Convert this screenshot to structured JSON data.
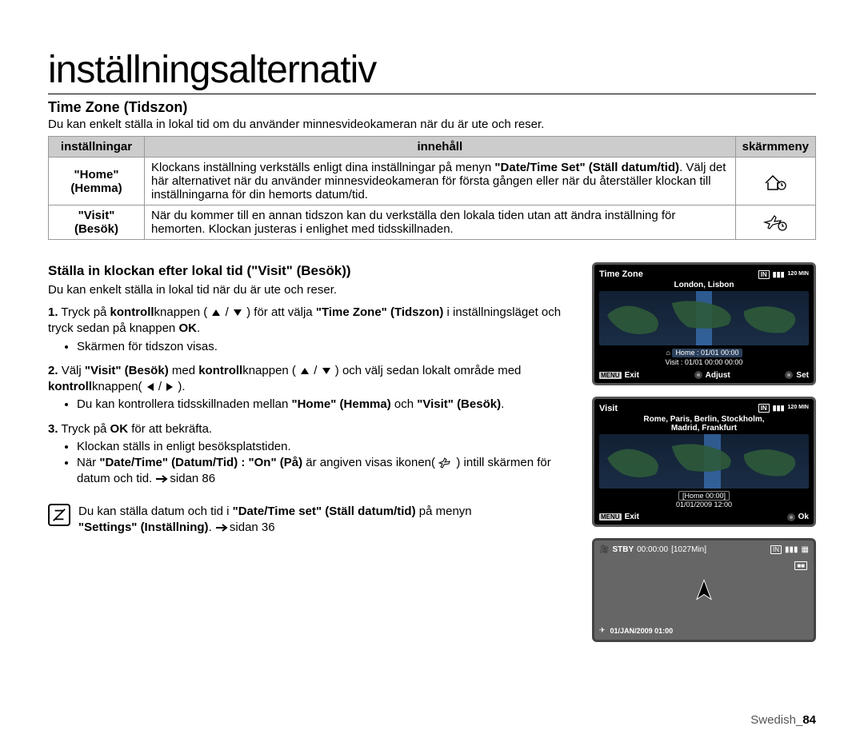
{
  "page_title": "inställningsalternativ",
  "section": {
    "heading": "Time Zone (Tidszon)",
    "desc": "Du kan enkelt ställa in lokal tid om du använder minnesvideokameran när du är ute och reser."
  },
  "table": {
    "headers": [
      "inställningar",
      "innehåll",
      "skärmmeny"
    ],
    "rows": [
      {
        "setting_q": "\"Home\"",
        "setting_p": "(Hemma)",
        "content_a": "Klockans inställning verkställs enligt dina inställningar på menyn ",
        "content_b": "\"Date/Time Set\" (Ställ datum/tid)",
        "content_c": ". Välj det här alternativet när du använder minnesvideokameran för första gången eller när du återställer klockan till inställningarna för din hemorts datum/tid.",
        "icon": "home"
      },
      {
        "setting_q": "\"Visit\"",
        "setting_p": "(Besök)",
        "content_a": "När du kommer till en annan tidszon kan du verkställa den lokala tiden utan att ändra inställning för hemorten. Klockan justeras i enlighet med tidsskillnaden.",
        "icon": "visit"
      }
    ]
  },
  "sub_heading": "Ställa in klockan efter lokal tid (\"Visit\" (Besök))",
  "sub_desc": "Du kan enkelt ställa in lokal tid när du är ute och reser.",
  "steps": {
    "s1_a": "Tryck på ",
    "s1_b": "kontroll",
    "s1_c": "knappen ( ",
    "s1_d": " ) för att välja ",
    "s1_e": "\"Time Zone\" (Tidszon)",
    "s1_f": " i inställningsläget och tryck sedan på knappen ",
    "s1_g": "OK",
    "s1_h": ".",
    "s1_bullet": "Skärmen för tidszon visas.",
    "s2_a": "Välj ",
    "s2_b": "\"Visit\" (Besök)",
    "s2_c": " med ",
    "s2_d": "kontroll",
    "s2_e": "knappen ( ",
    "s2_f": " ) och välj sedan lokalt område med ",
    "s2_g": "kontroll",
    "s2_h": "knappen( ",
    "s2_i": " ).",
    "s2_bullet_a": "Du kan kontrollera tidsskillnaden mellan ",
    "s2_bullet_b": "\"Home\" (Hemma)",
    "s2_bullet_c": " och ",
    "s2_bullet_d": "\"Visit\" (Besök)",
    "s2_bullet_e": ".",
    "s3_a": "Tryck på ",
    "s3_b": "OK",
    "s3_c": " för att bekräfta.",
    "s3_bullet1": "Klockan ställs in enligt besöksplatstiden.",
    "s3_bullet2_a": "När ",
    "s3_bullet2_b": "\"Date/Time\" (Datum/Tid) : \"On\" (På)",
    "s3_bullet2_c": " är angiven visas ikonen( ",
    "s3_bullet2_d": " ) intill skärmen för datum och tid.",
    "s3_bullet2_e": "sidan 86"
  },
  "note": {
    "a": "Du kan ställa datum och tid i ",
    "b": "\"Date/Time set\" (Ställ datum/tid)",
    "c": " på menyn ",
    "d": "\"Settings\" (Inställning)",
    "e": ".",
    "f": "sidan 36"
  },
  "lcd1": {
    "title": "Time Zone",
    "loc": "London, Lisbon",
    "home": "Home : 01/01 00:00",
    "visit": "Visit  : 01/01 00:00 00:00",
    "exit": "Exit",
    "adjust": "Adjust",
    "set": "Set",
    "menu": "MENU",
    "min": "120\nMIN"
  },
  "lcd2": {
    "title": "Visit",
    "loc1": "Rome, Paris, Berlin, Stockholm,",
    "loc2": "Madrid, Frankfurt",
    "home": "[Home 00:00]",
    "dt": "01/01/2009 12:00",
    "exit": "Exit",
    "ok": "Ok",
    "menu": "MENU",
    "min": "120\nMIN"
  },
  "lcd3": {
    "stby": "STBY",
    "time": "00:00:00",
    "rem": "[1027Min]",
    "bottom": "01/JAN/2009 01:00"
  },
  "footer_a": "Swedish_",
  "footer_b": "84"
}
